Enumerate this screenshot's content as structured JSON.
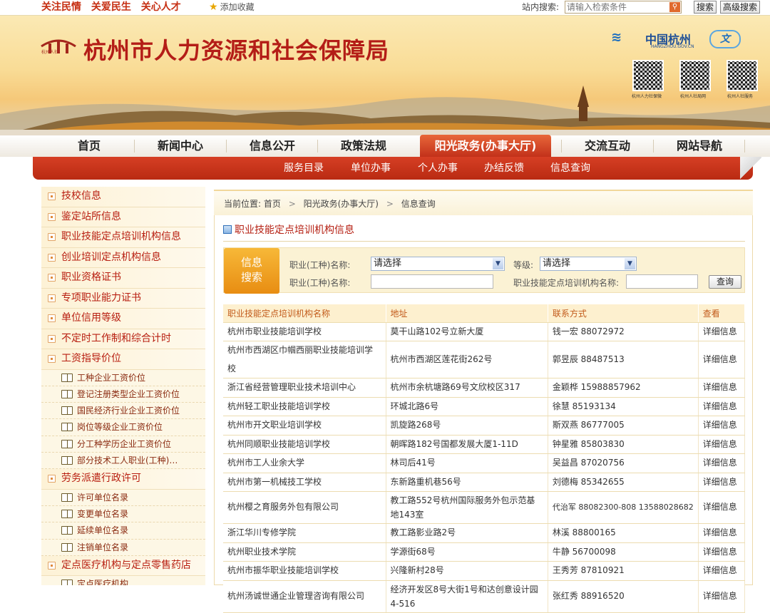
{
  "topbar": {
    "slogans": [
      "关注民情",
      "关爱民生",
      "关心人才"
    ],
    "favorite": "添加收藏",
    "search_label": "站内搜索:",
    "search_placeholder": "请输入检索条件",
    "search_button": "搜索",
    "advanced_search_button": "高级搜索"
  },
  "banner": {
    "logo_text": "杭州人社",
    "title": "杭州市人力资源和社会保障局",
    "partner_name": "中国杭州",
    "partner_domain": "HANGZHOU.GOV.CN",
    "qr_captions": [
      "杭州人力社保微",
      "杭州人社局网",
      "杭州人社服务"
    ]
  },
  "nav": {
    "items": [
      "首页",
      "新闻中心",
      "信息公开",
      "政策法规",
      "阳光政务(办事大厅)",
      "交流互动",
      "网站导航"
    ],
    "sub_items": [
      "服务目录",
      "单位办事",
      "个人办事",
      "办结反馈",
      "信息查询"
    ]
  },
  "sidebar": {
    "top_items": [
      "技校信息",
      "鉴定站所信息",
      "职业技能定点培训机构信息",
      "创业培训定点机构信息",
      "职业资格证书",
      "专项职业能力证书",
      "单位信用等级",
      "不定时工作制和综合计时",
      "工资指导价位"
    ],
    "wage_sub": [
      "工种企业工资价位",
      "登记注册类型企业工资价位",
      "国民经济行业企业工资价位",
      "岗位等级企业工资价位",
      "分工种学历企业工资价位",
      "部分技术工人职业(工种)…"
    ],
    "labor_item": "劳务派遣行政许可",
    "labor_sub": [
      "许可单位名录",
      "变更单位名录",
      "延续单位名录",
      "注销单位名录"
    ],
    "medical_item": "定点医疗机构与定点零售药店",
    "medical_sub": [
      "定点医疗机构"
    ]
  },
  "breadcrumb": {
    "label": "当前位置:",
    "parts": [
      "首页",
      "阳光政务(办事大厅)",
      "信息查询"
    ]
  },
  "panel": {
    "title": "职业技能定点培训机构信息",
    "form": {
      "badge_line1": "信息",
      "badge_line2": "搜索",
      "occupation_select_label": "职业(工种)名称:",
      "occupation_select_value": "请选择",
      "grade_label": "等级:",
      "grade_value": "请选择",
      "occupation_input_label": "职业(工种)名称:",
      "institution_label": "职业技能定点培训机构名称:",
      "query_button": "查询"
    },
    "table": {
      "headers": [
        "职业技能定点培训机构名称",
        "地址",
        "联系方式",
        "查看"
      ],
      "rows": [
        [
          "杭州市职业技能培训学校",
          "莫干山路102号立新大厦",
          "钱一宏 88072972",
          "详细信息"
        ],
        [
          "杭州市西湖区巾帼西丽职业技能培训学校",
          "杭州市西湖区莲花街262号",
          "郭昱辰 88487513",
          "详细信息"
        ],
        [
          "浙江省经营管理职业技术培训中心",
          "杭州市余杭塘路69号文欣校区317",
          "金颖桦 15988857962",
          "详细信息"
        ],
        [
          "杭州轻工职业技能培训学校",
          "环城北路6号",
          "徐慧 85193134",
          "详细信息"
        ],
        [
          "杭州市开文职业培训学校",
          "凯旋路268号",
          "斯双燕 86777005",
          "详细信息"
        ],
        [
          "杭州同顺职业技能培训学校",
          "朝晖路182号国都发展大厦1-11D",
          "钟星雅 85803830",
          "详细信息"
        ],
        [
          "杭州市工人业余大学",
          "林司后41号",
          "吴益昌 87020756",
          "详细信息"
        ],
        [
          "杭州市第一机械技工学校",
          "东新路重机巷56号",
          "刘德梅 85342655",
          "详细信息"
        ],
        [
          "杭州樱之育服务外包有限公司",
          "教工路552号杭州国际服务外包示范基地143室",
          "代治军 88082300-808 13588028682",
          "详细信息"
        ],
        [
          "浙江华川专修学院",
          "教工路影业路2号",
          "林溪 88800165",
          "详细信息"
        ],
        [
          "杭州职业技术学院",
          "学源街68号",
          "牛静 56700098",
          "详细信息"
        ],
        [
          "杭州市振华职业技能培训学校",
          "兴隆新村28号",
          "王秀芳 87810921",
          "详细信息"
        ],
        [
          "杭州汤诚世通企业管理咨询有限公司",
          "经济开发区8号大街1号和达创意设计园4-516",
          "张红秀 88916520",
          "详细信息"
        ]
      ]
    }
  },
  "colors": {
    "brand_red": "#b41d17",
    "nav_active": "#d4411f",
    "badge_orange": "#f0a020"
  }
}
